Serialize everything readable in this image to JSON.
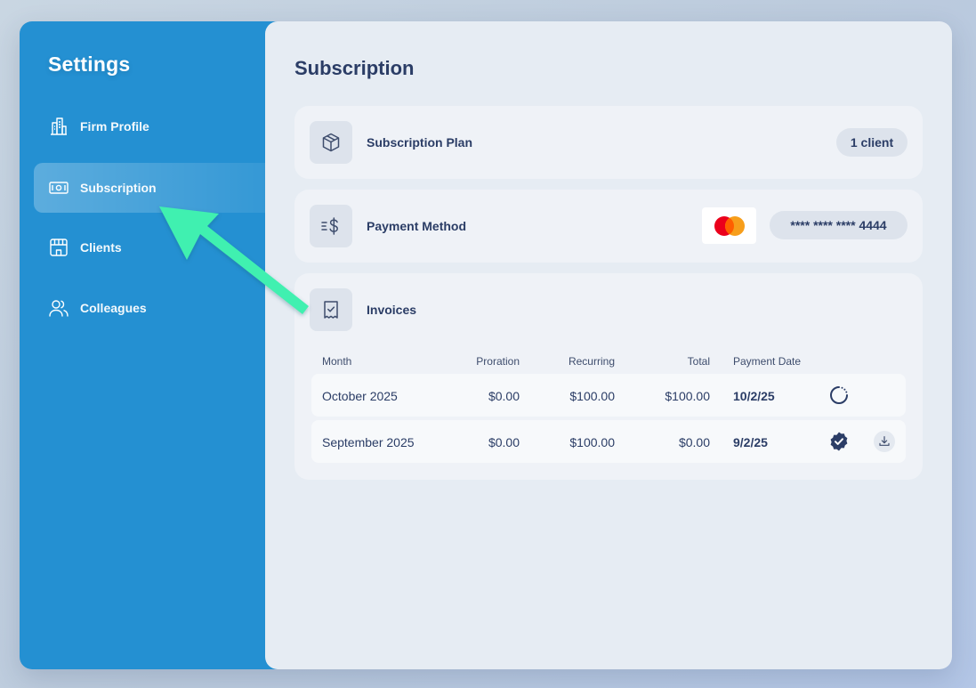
{
  "sidebar": {
    "title": "Settings",
    "items": [
      {
        "label": "Firm Profile",
        "icon": "building-icon",
        "active": false
      },
      {
        "label": "Subscription",
        "icon": "banknote-icon",
        "active": true
      },
      {
        "label": "Clients",
        "icon": "storefront-icon",
        "active": false
      },
      {
        "label": "Colleagues",
        "icon": "users-icon",
        "active": false
      }
    ]
  },
  "main": {
    "title": "Subscription",
    "plan": {
      "label": "Subscription Plan",
      "icon": "package-icon",
      "value": "1 client"
    },
    "payment": {
      "label": "Payment Method",
      "icon": "dollar-transfer-icon",
      "card_brand_icon": "mastercard-icon",
      "card_number": "**** **** **** 4444"
    },
    "invoices": {
      "label": "Invoices",
      "icon": "receipt-check-icon",
      "columns": [
        "Month",
        "Proration",
        "Recurring",
        "Total",
        "Payment Date"
      ],
      "rows": [
        {
          "month": "October 2025",
          "proration": "$0.00",
          "recurring": "$100.00",
          "total": "$100.00",
          "date": "10/2/25",
          "status": "pending",
          "downloadable": false
        },
        {
          "month": "September 2025",
          "proration": "$0.00",
          "recurring": "$100.00",
          "total": "$0.00",
          "date": "9/2/25",
          "status": "paid",
          "downloadable": true
        }
      ]
    }
  },
  "colors": {
    "sidebar_bg": "#2490d2",
    "main_bg": "#e6ecf3",
    "text_primary": "#2b3d66",
    "arrow": "#3ff0b0",
    "mc_red": "#eb001b",
    "mc_orange": "#f79e1b"
  }
}
